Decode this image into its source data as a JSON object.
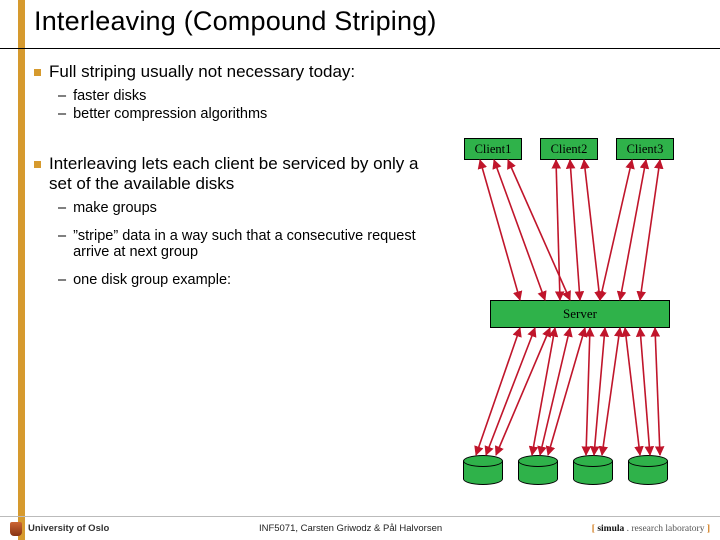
{
  "title": "Interleaving (Compound Striping)",
  "bullets": {
    "b1": "Full striping usually not necessary today:",
    "b1subs": [
      "faster disks",
      "better compression algorithms"
    ],
    "b2": "Interleaving lets each client be serviced by only a set of the available disks",
    "b2subs": [
      "make groups",
      "”stripe” data in a way such that a consecutive request arrive at next group",
      "one disk group example:"
    ]
  },
  "clients": [
    "Client1",
    "Client2",
    "Client3"
  ],
  "server": "Server",
  "footer": {
    "uni": "University of Oslo",
    "course": "INF5071, Carsten Griwodz & Pål Halvorsen",
    "lab_pre": "[ ",
    "lab_sim": "simula",
    "lab_dot": " . ",
    "lab_rest": "research laboratory",
    "lab_post": " ]"
  }
}
